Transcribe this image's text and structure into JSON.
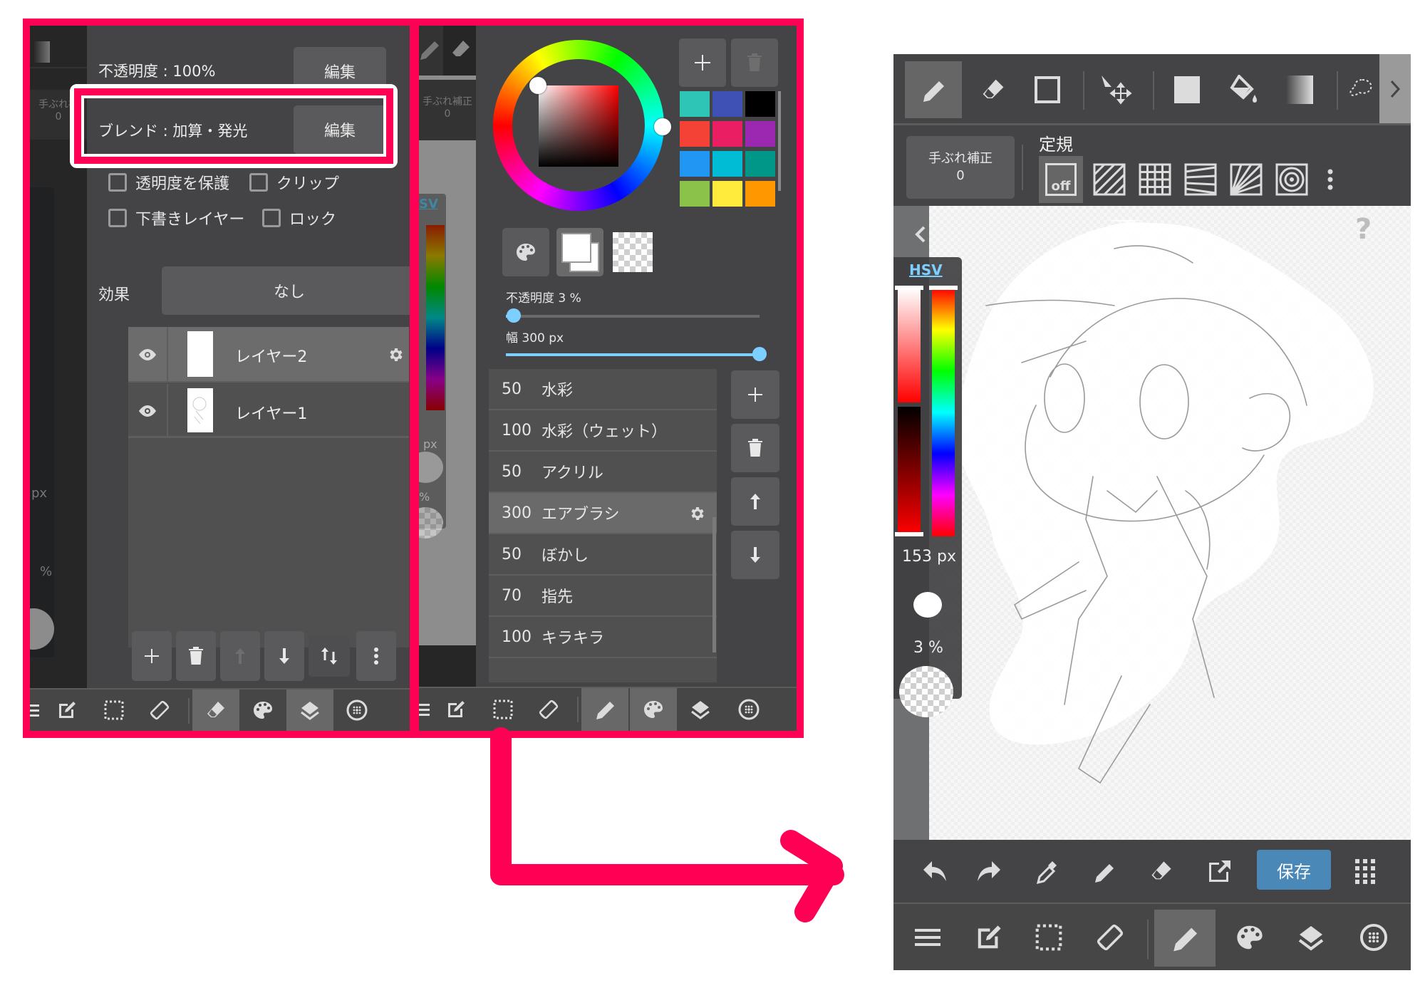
{
  "layer_panel": {
    "opacity_label": "不透明度 : 100%",
    "blend_label": "ブレンド : 加算・発光",
    "edit_button": "編集",
    "edit_button_2": "編集",
    "checkboxes": [
      {
        "label": "透明度を保護",
        "checked": false
      },
      {
        "label": "クリップ",
        "checked": false
      },
      {
        "label": "下書きレイヤー",
        "checked": false
      },
      {
        "label": "ロック",
        "checked": false
      }
    ],
    "effect_label": "効果",
    "effect_value": "なし",
    "layers": [
      {
        "name": "レイヤー2",
        "visible": true,
        "selected": true
      },
      {
        "name": "レイヤー1",
        "visible": true,
        "selected": false
      }
    ],
    "toolbar_icons": [
      "add-icon",
      "trash-icon",
      "move-up-icon",
      "move-down-icon",
      "merge-icon",
      "more-icon"
    ],
    "behind": {
      "stabilizer_label": "手ぶれ補",
      "stabilizer_value": "0",
      "size_unit": "px",
      "percent": "%"
    }
  },
  "brush_panel": {
    "palette_colors": [
      "#2ec4b6",
      "#3f51b5",
      "#000000",
      "#f44336",
      "#e91e63",
      "#9c27b0",
      "#2196f3",
      "#00bcd4",
      "#009688",
      "#8bc34a",
      "#ffeb3b",
      "#ff9800"
    ],
    "opacity_label": "不透明度 3 %",
    "opacity_value": 3,
    "width_label": "幅 300 px",
    "width_fraction": 1.0,
    "brushes": [
      {
        "size": "50",
        "name": "水彩"
      },
      {
        "size": "100",
        "name": "水彩（ウェット）"
      },
      {
        "size": "50",
        "name": "アクリル"
      },
      {
        "size": "300",
        "name": "エアブラシ",
        "selected": true
      },
      {
        "size": "50",
        "name": "ぼかし"
      },
      {
        "size": "70",
        "name": "指先"
      },
      {
        "size": "100",
        "name": "キラキラ"
      }
    ],
    "behind": {
      "stabilizer_label": "手ぶれ補正",
      "stabilizer_value": "0",
      "hsv_label": "SV",
      "size_unit": "px",
      "percent": "%"
    }
  },
  "canvas_screen": {
    "top_tools": [
      "pen-icon",
      "eraser-icon",
      "rectangle-icon",
      "move-icon",
      "fill-rect-icon",
      "bucket-icon",
      "gradient-icon",
      "lasso-icon"
    ],
    "stabilizer_label": "手ぶれ補正",
    "stabilizer_value": "0",
    "ruler_label": "定規",
    "ruler_off_label": "off",
    "hsv_label": "HSV",
    "brush_size": "153 px",
    "brush_opacity": "3 %",
    "save_button": "保存",
    "help": "?"
  },
  "bottom_nav": [
    "menu-icon",
    "edit-icon",
    "selection-icon",
    "rotate-icon",
    "pen-icon",
    "palette-icon",
    "layers-icon",
    "material-icon"
  ],
  "colors": {
    "highlight": "#ff0055",
    "accent": "#7dcfff",
    "save": "#4a88b8"
  }
}
